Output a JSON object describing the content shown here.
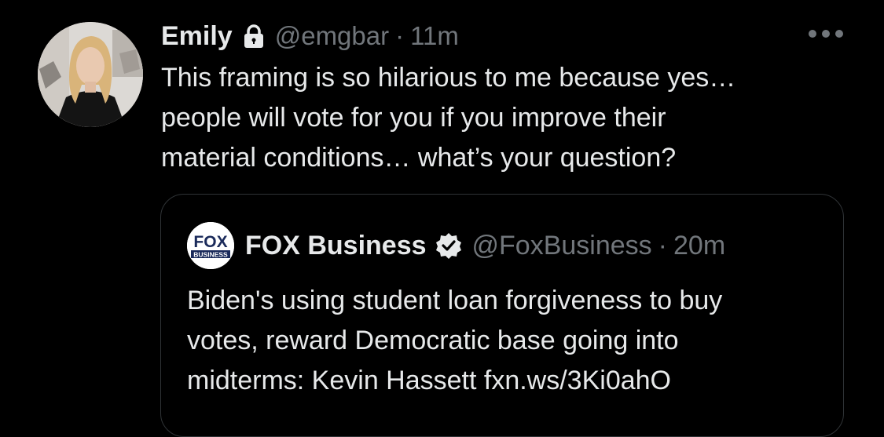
{
  "tweet": {
    "author_name": "Emily",
    "handle": "@emgbar",
    "separator": "·",
    "time": "11m",
    "text": "This framing is so hilarious to me because yes…\npeople will vote for you if you improve their\nmaterial conditions… what’s your question?",
    "icons": {
      "protected": "lock-icon",
      "more": "more-options-icon"
    }
  },
  "quoted_tweet": {
    "author_name": "FOX Business",
    "handle": "@FoxBusiness",
    "separator": "·",
    "time": "20m",
    "text": "Biden's using student loan forgiveness to buy\nvotes, reward Democratic base going into\nmidterms: Kevin Hassett fxn.ws/3Ki0ahO",
    "logo_text_top": "FOX",
    "logo_text_bottom": "BUSINESS",
    "icons": {
      "verified": "verified-badge-icon"
    }
  },
  "colors": {
    "background": "#000000",
    "primary_text": "#e7e9ea",
    "secondary_text": "#71767b",
    "border": "#2f3336"
  }
}
